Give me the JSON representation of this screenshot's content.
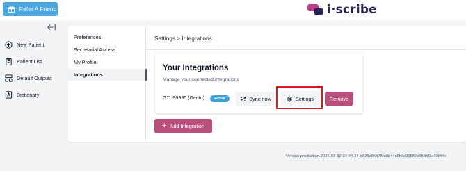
{
  "header": {
    "refer_label": "Refer A Friend",
    "logo_text": "i·scribe"
  },
  "sidebar": {
    "items": [
      {
        "label": "New Patient",
        "icon": "plus-circle-icon"
      },
      {
        "label": "Patient List",
        "icon": "clipboard-icon"
      },
      {
        "label": "Default Outputs",
        "icon": "layout-icon"
      },
      {
        "label": "Dictionary",
        "icon": "book-icon"
      }
    ]
  },
  "settings_menu": {
    "items": [
      {
        "label": "Preferences"
      },
      {
        "label": "Secretarial Access"
      },
      {
        "label": "My Profile"
      },
      {
        "label": "Integrations",
        "active": true
      }
    ]
  },
  "content": {
    "breadcrumb": "Settings > Integrations",
    "card": {
      "title": "Your Integrations",
      "subtitle": "Manage your connected integrations",
      "integration_name": "GTU99985 (Gentu)",
      "status_badge": "active",
      "sync_label": "Sync now",
      "settings_label": "Settings",
      "remove_label": "Remove"
    },
    "add_label": "Add Integration"
  },
  "footer": {
    "version": "Version production-2025-03-30-04-44-24-d825e66d78fe8b44c6b6c91587e35d5f3e10b5fe"
  },
  "colors": {
    "accent_blue": "#4ba7e0",
    "brand_magenta": "#b94f7b",
    "brand_navy": "#2a2559",
    "highlight_red": "#e01818"
  }
}
